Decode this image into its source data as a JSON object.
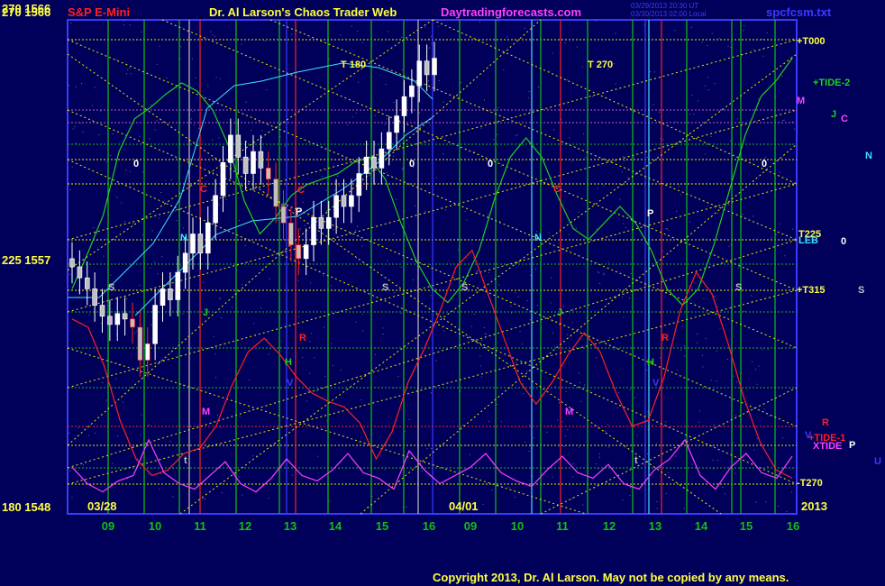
{
  "header": {
    "left_price": "270  1566",
    "title_product": "S&P E-Mini",
    "title_main": "Dr. Al Larson's Chaos Trader Web",
    "site": "Daytradingforecasts.com",
    "file": "spcfcsm.txt",
    "stamp_line1": "03/29/2013 20:30 UT",
    "stamp_line2": "03/30/2013 02:00 Local"
  },
  "footer": {
    "copyright": "Copyright 2013, Dr. Al Larson. May not be copied by any means."
  },
  "colors": {
    "background": "#00005a",
    "frame": "#3a3aff",
    "grid_green": "#11c011",
    "grid_yellow": "#e8e800",
    "tide_red": "#ff2020",
    "tide_magenta": "#ff40ff",
    "tide_green": "#20d020",
    "cyan": "#40e0ff"
  },
  "chart_data": {
    "type": "candlestick",
    "ylim": [
      1548,
      1566
    ],
    "y_ticks": [
      {
        "angle": 270,
        "price": 1566,
        "label": "270  1566"
      },
      {
        "angle": 225,
        "price": 1557,
        "label": "225  1557"
      },
      {
        "angle": 180,
        "price": 1548,
        "label": "180  1548"
      }
    ],
    "x_ticks": [
      "09",
      "10",
      "11",
      "12",
      "13",
      "14",
      "15",
      "16",
      "09",
      "10",
      "11",
      "12",
      "13",
      "14",
      "15",
      "16"
    ],
    "date_labels": [
      "03/28",
      "04/01",
      "2013"
    ],
    "price_series": [
      1557.0,
      1556.6,
      1556.2,
      1555.6,
      1555.2,
      1554.9,
      1555.3,
      1555.1,
      1554.8,
      1553.6,
      1554.2,
      1555.6,
      1556.2,
      1555.8,
      1556.8,
      1557.5,
      1558.2,
      1557.5,
      1558.6,
      1559.6,
      1560.8,
      1561.8,
      1561.0,
      1560.4,
      1561.2,
      1560.6,
      1560.2,
      1559.2,
      1558.6,
      1557.8,
      1557.3,
      1557.8,
      1558.8,
      1558.4,
      1558.8,
      1559.6,
      1559.2,
      1559.6,
      1560.4,
      1561.0,
      1560.6,
      1561.3,
      1561.9,
      1562.5,
      1563.2,
      1563.6,
      1564.5,
      1564.0,
      1564.6
    ],
    "series": [
      {
        "name": "TIDE-2",
        "color": "#20d020",
        "y": [
          1556.2,
          1557.5,
          1558.9,
          1561.2,
          1562.4,
          1562.8,
          1563.3,
          1563.7,
          1563.4,
          1562.7,
          1561.4,
          1559.4,
          1558.2,
          1558.8,
          1559.6,
          1560.0,
          1560.2,
          1560.4,
          1560.8,
          1561.0,
          1560.2,
          1558.6,
          1557.2,
          1556.2,
          1555.7,
          1556.4,
          1557.6,
          1559.5,
          1561.0,
          1561.7,
          1561.0,
          1559.6,
          1558.4,
          1558.0,
          1558.6,
          1559.2,
          1558.6,
          1557.6,
          1556.2,
          1555.6,
          1556.2,
          1557.8,
          1559.8,
          1561.8,
          1563.2,
          1563.8,
          1564.6
        ]
      },
      {
        "name": "TIDE-1",
        "color": "#ff2020",
        "y": [
          1555.1,
          1554.8,
          1553.4,
          1551.4,
          1550.0,
          1549.4,
          1549.6,
          1550.2,
          1550.4,
          1551.2,
          1552.7,
          1553.9,
          1554.4,
          1553.8,
          1553.0,
          1552.4,
          1552.1,
          1551.9,
          1551.3,
          1550.0,
          1551.0,
          1552.8,
          1554.0,
          1555.4,
          1557.0,
          1557.6,
          1556.0,
          1554.4,
          1552.8,
          1552.0,
          1552.8,
          1553.8,
          1554.6,
          1553.9,
          1552.4,
          1551.2,
          1551.4,
          1553.0,
          1555.4,
          1556.8,
          1556.0,
          1554.2,
          1552.2,
          1550.6,
          1549.6,
          1549.3
        ]
      },
      {
        "name": "XTIDE",
        "color": "#ff40ff",
        "y": [
          1549.7,
          1549.1,
          1548.8,
          1549.2,
          1549.4,
          1550.7,
          1549.5,
          1549.1,
          1548.9,
          1549.4,
          1549.9,
          1549.1,
          1548.8,
          1549.3,
          1550.0,
          1549.4,
          1549.2,
          1549.6,
          1550.2,
          1549.5,
          1549.3,
          1548.9,
          1550.3,
          1549.6,
          1549.1,
          1549.4,
          1549.7,
          1550.2,
          1549.5,
          1549.2,
          1549.0,
          1549.6,
          1550.1,
          1549.5,
          1549.3,
          1549.8,
          1549.1,
          1548.9,
          1549.6,
          1550.0,
          1550.7,
          1549.4,
          1548.9,
          1549.7,
          1550.2,
          1549.5,
          1549.3,
          1550.1
        ]
      }
    ],
    "annotations_in_plot": [
      {
        "text": "T  180",
        "color": "#ffff40"
      },
      {
        "text": "T  270",
        "color": "#ffff40"
      },
      {
        "text": "0",
        "color": "#ffffff"
      },
      {
        "text": "0",
        "color": "#ffffff"
      },
      {
        "text": "0",
        "color": "#ffffff"
      },
      {
        "text": "0",
        "color": "#ffffff"
      },
      {
        "text": "N",
        "color": "#40e0ff"
      },
      {
        "text": "N",
        "color": "#40e0ff"
      },
      {
        "text": "P",
        "color": "#ffffff"
      },
      {
        "text": "P",
        "color": "#ffffff"
      },
      {
        "text": "S",
        "color": "#c0c0c0"
      },
      {
        "text": "S",
        "color": "#c0c0c0"
      },
      {
        "text": "S",
        "color": "#c0c0c0"
      },
      {
        "text": "S",
        "color": "#c0c0c0"
      },
      {
        "text": "C",
        "color": "#ff2020"
      },
      {
        "text": "C",
        "color": "#ff2020"
      },
      {
        "text": "C",
        "color": "#ff2020"
      },
      {
        "text": "J",
        "color": "#20d020"
      },
      {
        "text": "J",
        "color": "#20d020"
      },
      {
        "text": "H",
        "color": "#20d020"
      },
      {
        "text": "H",
        "color": "#20d020"
      },
      {
        "text": "R",
        "color": "#ff2020"
      },
      {
        "text": "R",
        "color": "#ff2020"
      },
      {
        "text": "M",
        "color": "#ff40ff"
      },
      {
        "text": "M",
        "color": "#ff40ff"
      },
      {
        "text": "V",
        "color": "#3a3aff"
      },
      {
        "text": "V",
        "color": "#3a3aff"
      },
      {
        "text": "t",
        "color": "#c0c0c0"
      },
      {
        "text": "t",
        "color": "#c0c0c0"
      }
    ],
    "right_labels": [
      {
        "text": "+T000",
        "color": "#ffff40"
      },
      {
        "text": "+TIDE-2",
        "color": "#20d020"
      },
      {
        "text": "M",
        "color": "#ff40ff"
      },
      {
        "text": "J",
        "color": "#20d020"
      },
      {
        "text": "C",
        "color": "#ff40ff"
      },
      {
        "text": "N",
        "color": "#40e0ff"
      },
      {
        "text": "T225",
        "color": "#ffff40"
      },
      {
        "text": "LEB",
        "color": "#40e0ff"
      },
      {
        "text": "0",
        "color": "#ffffff"
      },
      {
        "text": "+T315",
        "color": "#ffff40"
      },
      {
        "text": "S",
        "color": "#c0c0c0"
      },
      {
        "text": "R",
        "color": "#ff2020"
      },
      {
        "text": "+TIDE-1",
        "color": "#ff2020"
      },
      {
        "text": "V",
        "color": "#3a3aff"
      },
      {
        "text": "XTIDE",
        "color": "#ff40ff"
      },
      {
        "text": "P",
        "color": "#ffffff"
      },
      {
        "text": "U",
        "color": "#3a3aff"
      },
      {
        "text": "-T270",
        "color": "#ffff40"
      }
    ]
  }
}
